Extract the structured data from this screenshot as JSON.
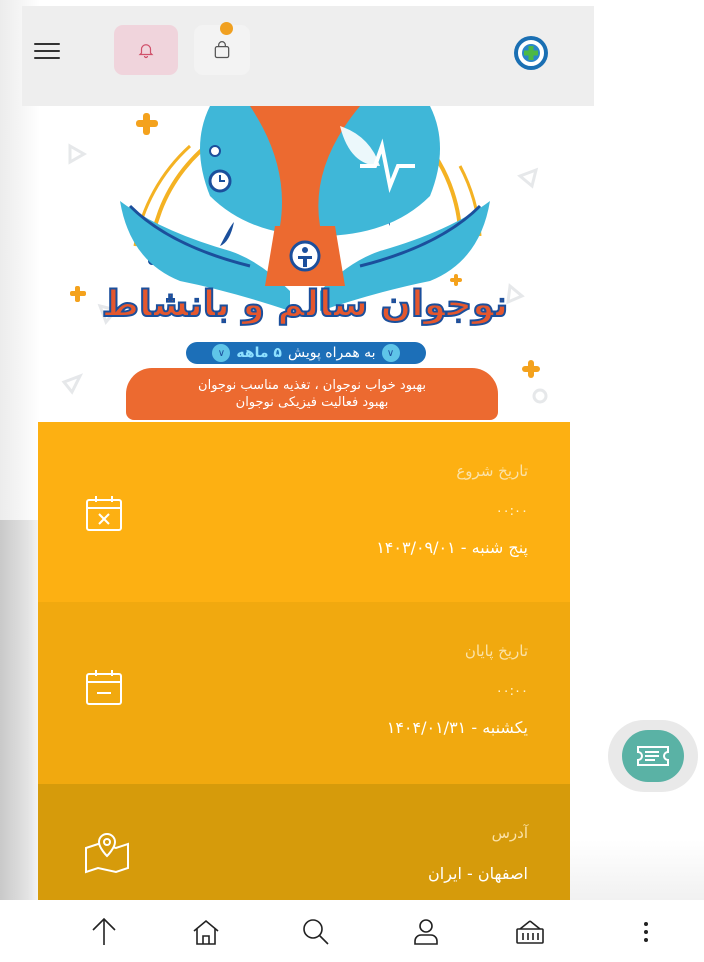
{
  "header": {
    "icons": [
      "menu-icon",
      "bell-icon",
      "shopping-bag-icon",
      "logo"
    ],
    "cart_badge_color": "#f0a020",
    "bell_bg_color": "#f0d4dc"
  },
  "poster": {
    "title": "نوجوان سالم و بانشاط",
    "pill_prefix": "به همراه پویش",
    "pill_highlight": "۵ ماهه",
    "banner_line1": "بهبود خواب نوجوان ، تغذیه مناسب نوجوان",
    "banner_line2": "بهبود فعالیت فیزیکی نوجوان"
  },
  "start": {
    "label": "تاریخ شروع",
    "time": "۰۰:۰۰",
    "date": "پنج شنبه - ۱۴۰۳/۰۹/۰۱",
    "icon": "calendar-x-icon",
    "color": "#fdb012"
  },
  "end": {
    "label": "تاریخ پایان",
    "time": "۰۰:۰۰",
    "date": "یکشنبه - ۱۴۰۴/۰۱/۳۱",
    "icon": "calendar-minus-icon",
    "color": "#f1a90f"
  },
  "address": {
    "label": "آدرس",
    "value": "اصفهان - ایران",
    "icon": "map-pin-icon",
    "color": "#d69b0b"
  },
  "fab": {
    "icon": "ticket-icon",
    "color": "#5ab2a5"
  },
  "bottom_nav": {
    "icons": [
      "arrow-up-icon",
      "home-icon",
      "search-icon",
      "user-icon",
      "basket-icon",
      "more-vertical-icon"
    ]
  }
}
